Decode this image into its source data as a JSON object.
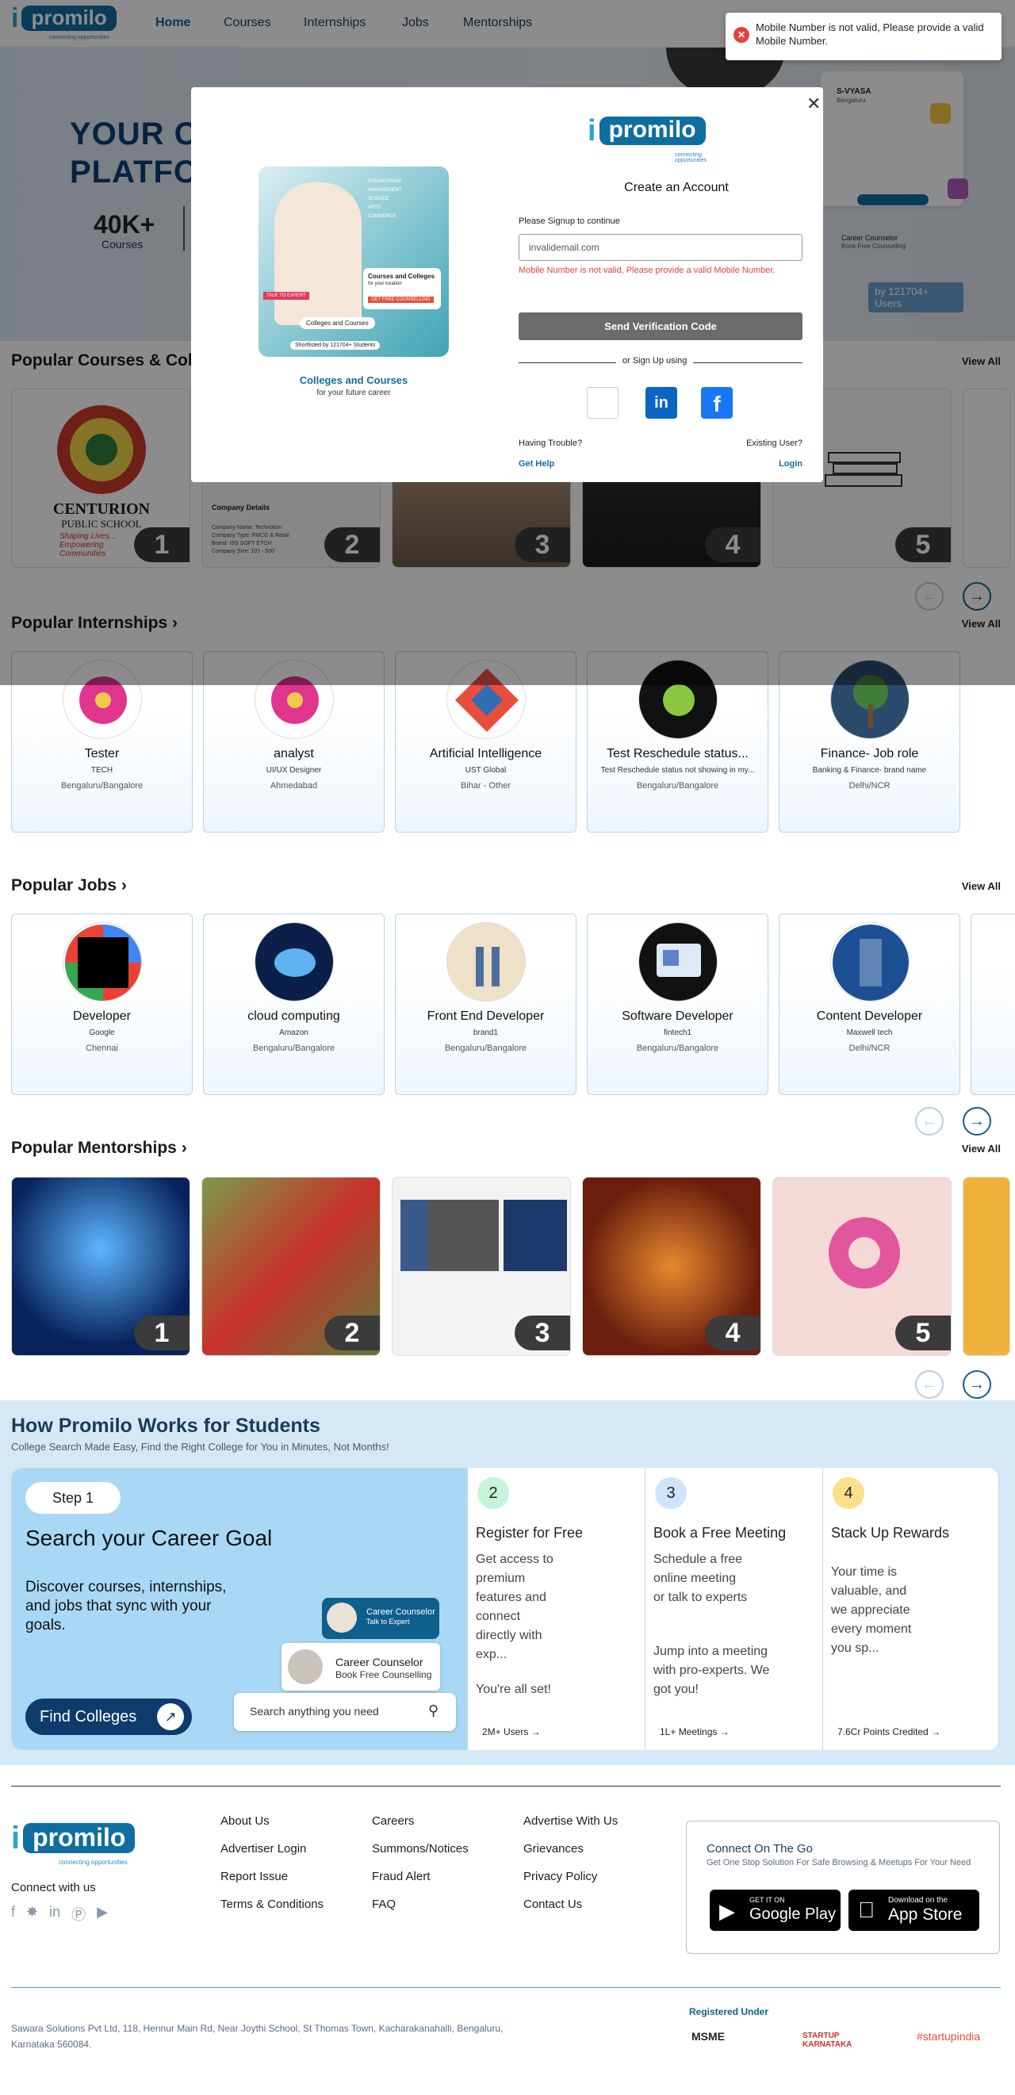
{
  "header": {
    "logo_mark": "i",
    "logo_text": "promilo",
    "logo_tagline": "connecting opportunities",
    "nav": [
      "Home",
      "Courses",
      "Internships",
      "Jobs",
      "Mentorships"
    ]
  },
  "toast": {
    "message": "Mobile Number is not valid, Please provide a valid Mobile Number."
  },
  "hero": {
    "title_line1": "YOUR C",
    "title_line2": "PLATFO",
    "stat_value": "40K+",
    "stat_label": "Courses",
    "card_name": "S-VYASA",
    "card_loc": "Bengaluru",
    "counselor_title": "Career Counselor",
    "counselor_sub": "Book Free Counselling",
    "shortlisted": "by 121704+ Users"
  },
  "modal": {
    "promo_caption": "Colleges and Courses",
    "promo_sub": "for your future career",
    "promo_card_title": "Courses and Colleges",
    "promo_card_sub": "for your location",
    "promo_cta": "GET FREE COUNSELLING",
    "promo_talk": "TALK TO EXPERT",
    "promo_chip": "Colleges and Courses",
    "promo_shortlisted": "Shortlisted by 121704+ Students",
    "promo_tags": [
      "ENGINEERING",
      "MANAGEMENT",
      "SCIENCE",
      "ARTS",
      "COMMERCE"
    ],
    "heading": "Create an Account",
    "signup_label": "Please Signup to continue",
    "input_value": "invalidemail.com",
    "error": "Mobile Number is not valid, Please provide a valid Mobile Number.",
    "send_button": "Send Verification Code",
    "or_text": "or Sign Up using",
    "trouble_label": "Having Trouble?",
    "get_help": "Get Help",
    "existing_label": "Existing User?",
    "login": "Login"
  },
  "courses": {
    "title": "Popular Courses & Col",
    "view_all": "View All",
    "school_name": "CENTURION",
    "school_sub": "PUBLIC SCHOOL",
    "school_motto": "Shaping Lives... Empowering Communities",
    "company_details": "Company Details",
    "company_lines": [
      "Company Name: Technotion",
      "Company Type: FMCG & Retail",
      "Brand: ISS SOFT ETCH",
      "Company Size: 101 - 500"
    ],
    "ranks": [
      "1",
      "2",
      "3",
      "4",
      "5"
    ]
  },
  "internships": {
    "title": "Popular Internships",
    "view_all": "View All",
    "items": [
      {
        "title": "Tester",
        "org": "TECH",
        "location": "Bengaluru/Bangalore"
      },
      {
        "title": "analyst",
        "org": "UI/UX Designer",
        "location": "Ahmedabad"
      },
      {
        "title": "Artificial Intelligence",
        "org": "UST Global",
        "location": "Bihar - Other"
      },
      {
        "title": "Test Reschedule status...",
        "org": "Test Reschedule status not showing in my...",
        "location": "Bengaluru/Bangalore"
      },
      {
        "title": "Finance- Job role",
        "org": "Banking & Finance- brand name",
        "location": "Delhi/NCR"
      }
    ]
  },
  "jobs": {
    "title": "Popular Jobs",
    "view_all": "View All",
    "items": [
      {
        "title": "Developer",
        "org": "Google",
        "location": "Chennai"
      },
      {
        "title": "cloud computing",
        "org": "Amazon",
        "location": "Bengaluru/Bangalore"
      },
      {
        "title": "Front End Developer",
        "org": "brand1",
        "location": "Bengaluru/Bangalore"
      },
      {
        "title": "Software Developer",
        "org": "fintech1",
        "location": "Bengaluru/Bangalore"
      },
      {
        "title": "Content Developer",
        "org": "Maxwell tech",
        "location": "Delhi/NCR"
      }
    ]
  },
  "mentorships": {
    "title": "Popular Mentorships",
    "view_all": "View All",
    "ranks": [
      "1",
      "2",
      "3",
      "4",
      "5"
    ]
  },
  "how": {
    "title": "How Promilo Works for Students",
    "subtitle": "College Search Made Easy, Find the Right College for You in Minutes, Not Months!",
    "step1_label": "Step 1",
    "step1_title": "Search your Career Goal",
    "step1_desc": "Discover courses, internships, and jobs that sync with your goals.",
    "counselor_title": "Career Counselor",
    "counselor_sub": "Talk to Expert",
    "counselor2_title": "Career Counselor",
    "counselor2_sub": "Book Free Counselling",
    "search_placeholder": "Search anything you need",
    "find_button": "Find Colleges",
    "steps": [
      {
        "num": "2",
        "title": "Register for Free",
        "desc": "Get access to premium features and connect directly with exp...",
        "extra": "You're all set!",
        "foot": "2M+ Users"
      },
      {
        "num": "3",
        "title": "Book a Free Meeting",
        "desc": "Schedule a free online meeting or talk to experts",
        "extra": "Jump into a meeting with pro-experts. We got you!",
        "foot": "1L+ Meetings"
      },
      {
        "num": "4",
        "title": "Stack Up Rewards",
        "desc": "Your time is valuable, and we appreciate every moment you sp...",
        "extra": "",
        "foot": "7.6Cr Points Credited"
      }
    ]
  },
  "footer": {
    "connect_label": "Connect with us",
    "links_col1": [
      "About Us",
      "Advertiser Login",
      "Report Issue",
      "Terms & Conditions"
    ],
    "links_col2": [
      "Careers",
      "Summons/Notices",
      "Fraud Alert",
      "FAQ"
    ],
    "links_col3": [
      "Advertise With Us",
      "Grievances",
      "Privacy Policy",
      "Contact Us"
    ],
    "app_title": "Connect On The Go",
    "app_sub": "Get One Stop Solution For Safe Browsing & Meetups For Your Need",
    "gp_small": "GET IT ON",
    "gp_big": "Google Play",
    "as_small": "Download on the",
    "as_big": "App Store",
    "address": "Sawara Solutions Pvt Ltd, 118, Hennur Main Rd, Near Joythi School, St Thomas Town, Kacharakanahalli, Bengaluru, Karnataka 560084.",
    "registered": "Registered Under",
    "reg_logos": [
      "MSME",
      "STARTUP KARNATAKA",
      "#startupindia"
    ]
  }
}
